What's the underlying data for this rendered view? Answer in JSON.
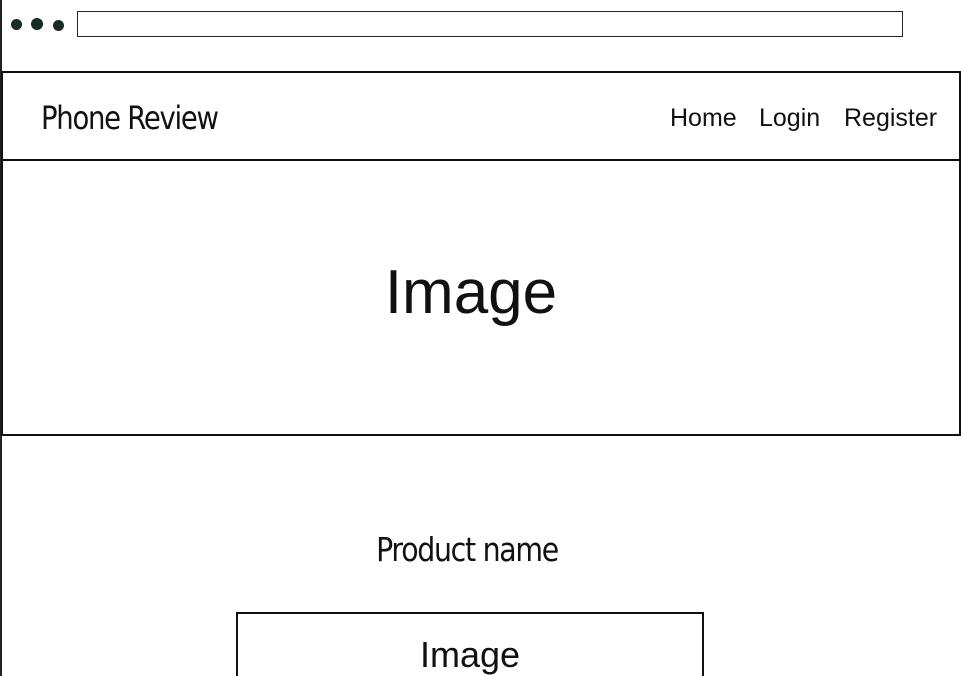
{
  "browser": {
    "window_controls": [
      "dot",
      "dot",
      "dot"
    ],
    "address_bar_value": ""
  },
  "navbar": {
    "brand": "Phone Review",
    "links": [
      {
        "label": "Home"
      },
      {
        "label": "Login"
      },
      {
        "label": "Register"
      }
    ]
  },
  "hero": {
    "image_label": "Image"
  },
  "product": {
    "name": "Product name",
    "image_label": "Image"
  }
}
